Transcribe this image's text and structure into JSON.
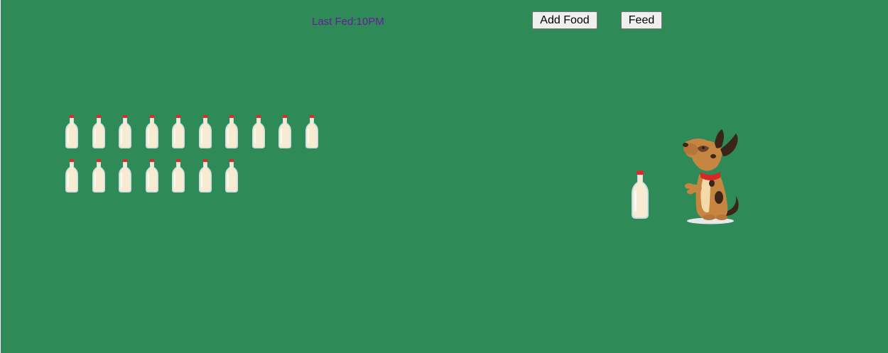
{
  "status": {
    "last_fed_label": "Last Fed:10PM"
  },
  "controls": {
    "add_food_label": "Add Food",
    "feed_label": "Feed"
  },
  "food_stock": {
    "count": 17,
    "item_icon": "milk-bottle-icon"
  },
  "pet": {
    "icon": "dog-icon"
  },
  "colors": {
    "background": "#2e8b57",
    "last_fed_text": "#6a1b9a",
    "bottle_cap": "#d32f2f",
    "milk": "#f7ecd2",
    "dog_body": "#c68642",
    "dog_collar": "#d62828"
  }
}
